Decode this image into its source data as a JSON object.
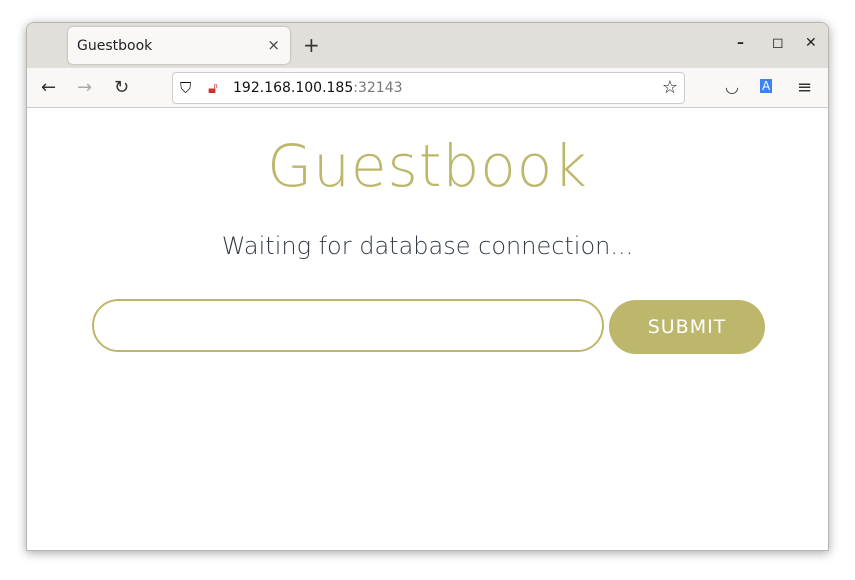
{
  "browser": {
    "tab_title": "Guestbook",
    "close_tab": "×",
    "new_tab": "+",
    "minimize": "–",
    "maximize": "◻",
    "close": "✕",
    "back": "←",
    "forward": "→",
    "reload": "↻",
    "url_host": "192.168.100.185",
    "url_port": ":32143",
    "bookmark": "☆",
    "pocket": "◡",
    "translate": "A",
    "menu": "≡"
  },
  "page": {
    "title": "Guestbook",
    "status": "Waiting for database connection...",
    "input_value": "",
    "submit_label": "SUBMIT"
  },
  "colors": {
    "accent": "#bdb76b"
  }
}
